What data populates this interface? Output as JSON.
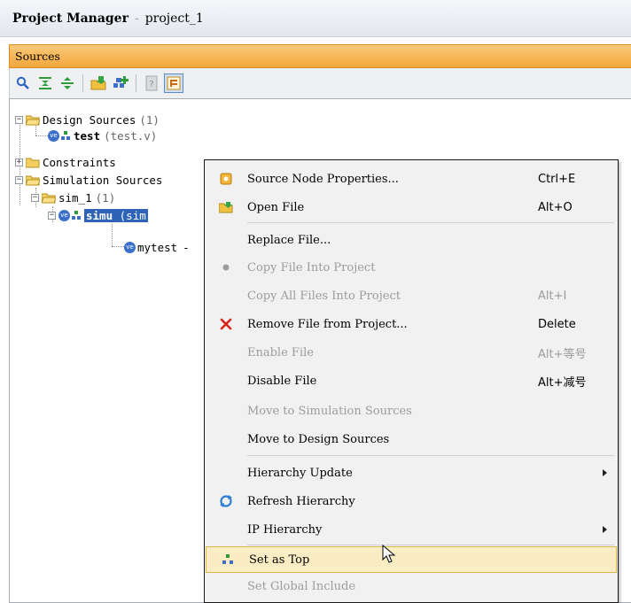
{
  "window": {
    "app_name": "Project Manager",
    "separator": "-",
    "project_name": "project_1"
  },
  "panel": {
    "title": "Sources"
  },
  "toolbar": {
    "buttons": [
      "search-icon",
      "collapse-all-icon",
      "expand-all-icon",
      "add-sources-icon",
      "add-hierarchy-icon",
      "properties-icon",
      "show-hierarchy-icon"
    ]
  },
  "tree": {
    "design_sources": {
      "label": "Design Sources",
      "count": "(1)"
    },
    "test": {
      "name": "test",
      "file": "(test.v)"
    },
    "constraints": {
      "label": "Constraints"
    },
    "simulation_sources": {
      "label": "Simulation Sources"
    },
    "sim_1": {
      "label": "sim_1",
      "count": "(1)"
    },
    "simu": {
      "name": "simu",
      "file": "(sim"
    },
    "mytest": {
      "name": "mytest",
      "suffix": "-"
    }
  },
  "context_menu": {
    "items": [
      {
        "label": "Source Node Properties...",
        "shortcut": "Ctrl+E",
        "icon": "properties-icon",
        "enabled": true
      },
      {
        "label": "Open File",
        "shortcut": "Alt+O",
        "icon": "open-file-icon",
        "enabled": true
      },
      {
        "label": "Replace File...",
        "shortcut": "",
        "icon": "",
        "enabled": true
      },
      {
        "label": "Copy File Into Project",
        "shortcut": "",
        "icon": "dot-icon",
        "enabled": false
      },
      {
        "label": "Copy All Files Into Project",
        "shortcut": "Alt+I",
        "icon": "",
        "enabled": false
      },
      {
        "label": "Remove File from Project...",
        "shortcut": "Delete",
        "icon": "remove-icon",
        "enabled": true
      },
      {
        "label": "Enable File",
        "shortcut": "Alt+等号",
        "icon": "",
        "enabled": false
      },
      {
        "label": "Disable File",
        "shortcut": "Alt+减号",
        "icon": "",
        "enabled": true
      },
      {
        "label": "Move to Simulation Sources",
        "shortcut": "",
        "icon": "",
        "enabled": false
      },
      {
        "label": "Move to Design Sources",
        "shortcut": "",
        "icon": "",
        "enabled": true
      },
      {
        "label": "Hierarchy Update",
        "shortcut": "",
        "icon": "",
        "enabled": true,
        "submenu": true
      },
      {
        "label": "Refresh Hierarchy",
        "shortcut": "",
        "icon": "refresh-icon",
        "enabled": true
      },
      {
        "label": "IP Hierarchy",
        "shortcut": "",
        "icon": "",
        "enabled": true,
        "submenu": true
      },
      {
        "label": "Set as Top",
        "shortcut": "",
        "icon": "set-top-icon",
        "enabled": true,
        "highlighted": true
      },
      {
        "label": "Set Global Include",
        "shortcut": "",
        "icon": "",
        "enabled": false
      }
    ]
  },
  "colors": {
    "panel_header": "#f3a63a",
    "selection": "#2f63b8",
    "menu_highlight": "#fbedc3",
    "remove_icon": "#d7261e"
  }
}
